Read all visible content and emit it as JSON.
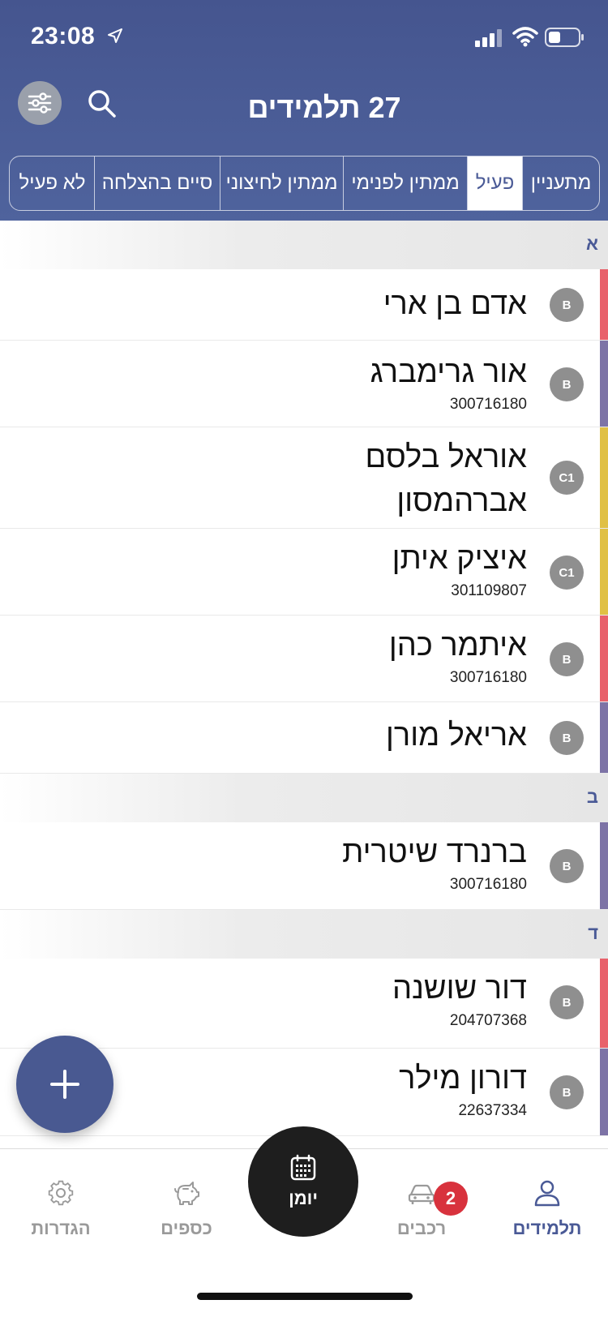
{
  "status": {
    "time": "23:08"
  },
  "header": {
    "title": "27 תלמידים",
    "tabs": [
      {
        "label": "מתעניין",
        "active": false
      },
      {
        "label": "פעיל",
        "active": true
      },
      {
        "label": "ממתין לפנימי",
        "active": false
      },
      {
        "label": "ממתין לחיצוני",
        "active": false
      },
      {
        "label": "סיים בהצלחה",
        "active": false
      },
      {
        "label": "לא פעיל",
        "active": false
      }
    ]
  },
  "colors": {
    "header": "#4a5a96",
    "accent_red": "#e8616b",
    "accent_purple": "#7d73a6",
    "accent_yellow": "#e0c044",
    "badge": "#8f8f8f",
    "notification": "#d8323d"
  },
  "sections": [
    {
      "letter": "א",
      "students": [
        {
          "badge": "B",
          "name": "אדם בן ארי",
          "id": "",
          "accent": "#e8616b"
        },
        {
          "badge": "B",
          "name": "אור גרימברג",
          "id": "300716180",
          "accent": "#7d73a6"
        },
        {
          "badge": "C1",
          "name": "אוראל בלסם",
          "name2": "אברהמסון",
          "id": "",
          "accent": "#e0c044"
        },
        {
          "badge": "C1",
          "name": "איציק איתן",
          "id": "301109807",
          "accent": "#e0c044"
        },
        {
          "badge": "B",
          "name": "איתמר כהן",
          "id": "300716180",
          "accent": "#e8616b"
        },
        {
          "badge": "B",
          "name": "אריאל מורן",
          "id": "",
          "accent": "#7d73a6"
        }
      ]
    },
    {
      "letter": "ב",
      "students": [
        {
          "badge": "B",
          "name": "ברנרד שיטרית",
          "id": "300716180",
          "accent": "#7d73a6"
        }
      ]
    },
    {
      "letter": "ד",
      "students": [
        {
          "badge": "B",
          "name": "דור שושנה",
          "id": "204707368",
          "accent": "#e8616b"
        },
        {
          "badge": "B",
          "name": "דורון מילר",
          "id": "22637334",
          "accent": "#7d73a6"
        }
      ]
    }
  ],
  "nav": {
    "students": "תלמידים",
    "cars": "רכבים",
    "cars_badge": "2",
    "diary": "יומן",
    "money": "כספים",
    "settings": "הגדרות"
  }
}
